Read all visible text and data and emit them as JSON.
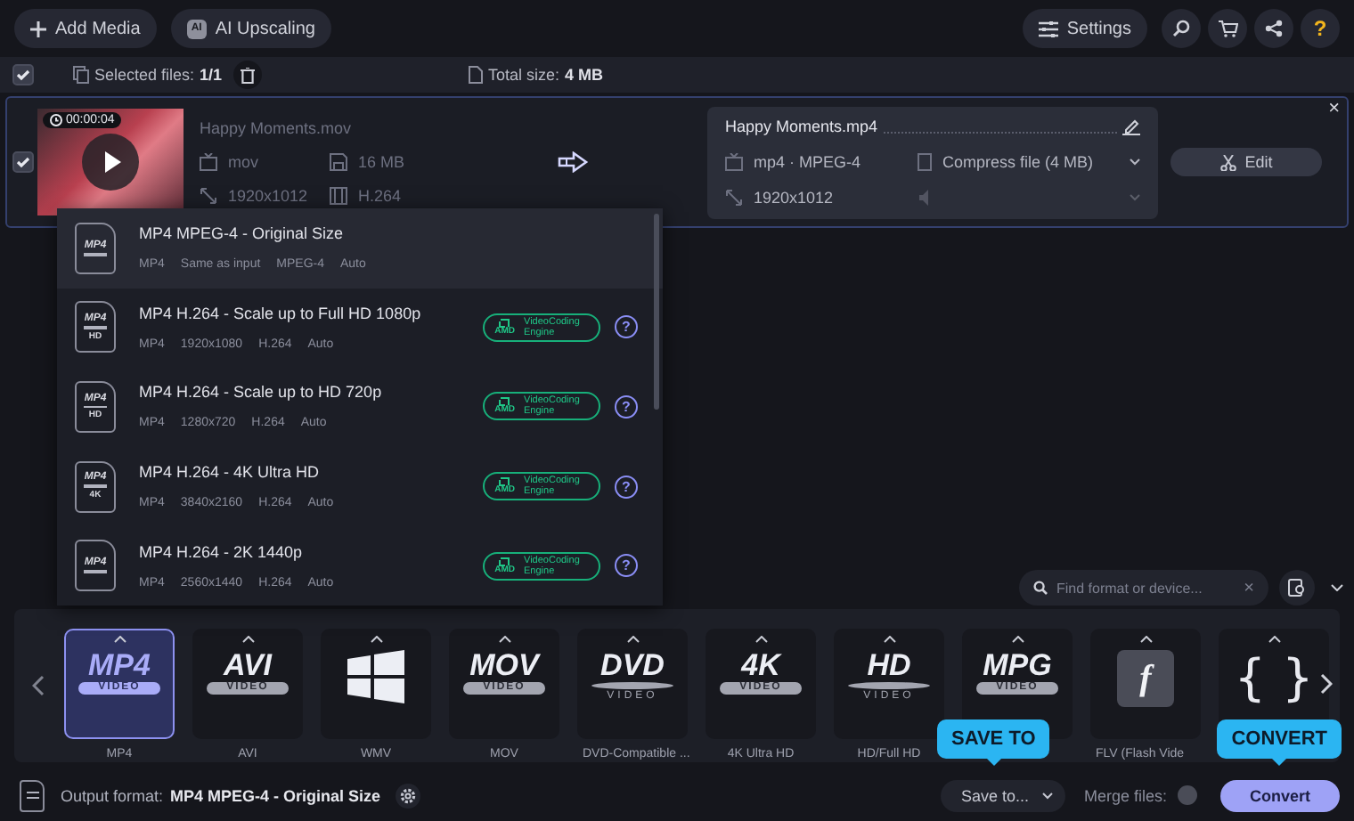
{
  "toolbar": {
    "left_buttons": [
      {
        "kind": "add",
        "label": "Add Media"
      },
      {
        "kind": "ai",
        "label": "AI Upscaling",
        "icon_text": "AI"
      }
    ],
    "settings": "Settings",
    "help": "?"
  },
  "selection": {
    "all_checked": true,
    "selected_label": "Selected files:",
    "selected_count": "1/1",
    "total_label": "Total size:",
    "total_value": "4 MB"
  },
  "file": {
    "checked": true,
    "duration": "00:00:04",
    "source": {
      "name": "Happy Moments.mov",
      "format": "mov",
      "size": "16 MB",
      "resolution": "1920x1012",
      "codec": "H.264"
    },
    "output": {
      "name": "Happy Moments.mp4",
      "format": "mp4 · MPEG-4",
      "compress": "Compress file (4 MB)",
      "resolution": "1920x1012",
      "audio_disabled": true
    },
    "edit": "Edit",
    "close": "×"
  },
  "presets": [
    {
      "title": "MP4 MPEG-4 - Original Size",
      "icon_label": "MP4",
      "specs": [
        "MP4",
        "Same as input",
        "MPEG-4",
        "Auto"
      ],
      "selected": true
    },
    {
      "title": "MP4 H.264 - Scale up to Full HD 1080p",
      "icon_label": "MP4",
      "icon_sub": "HD",
      "specs": [
        "MP4",
        "1920x1080",
        "H.264",
        "Auto"
      ],
      "badge": {
        "vendor": "AMD",
        "text": "VideoCoding Engine"
      },
      "help": "?",
      "selected": false
    },
    {
      "title": "MP4 H.264 - Scale up to HD 720p",
      "icon_label": "MP4",
      "icon_sub": "HD",
      "specs": [
        "MP4",
        "1280x720",
        "H.264",
        "Auto"
      ],
      "badge": {
        "vendor": "AMD",
        "text": "VideoCoding Engine"
      },
      "help": "?",
      "selected": false
    },
    {
      "title": "MP4 H.264 - 4K Ultra HD",
      "icon_label": "MP4",
      "icon_sub": "4K",
      "specs": [
        "MP4",
        "3840x2160",
        "H.264",
        "Auto"
      ],
      "badge": {
        "vendor": "AMD",
        "text": "VideoCoding Engine"
      },
      "help": "?",
      "selected": false
    },
    {
      "title": "MP4 H.264 - 2K 1440p",
      "icon_label": "MP4",
      "specs": [
        "MP4",
        "2560x1440",
        "H.264",
        "Auto"
      ],
      "badge": {
        "vendor": "AMD",
        "text": "VideoCoding Engine"
      },
      "help": "?",
      "selected": false
    }
  ],
  "format_search": {
    "placeholder": "Find format or device...",
    "clear": "×"
  },
  "formats": [
    {
      "kind": "band",
      "logo": "MP4",
      "sub": "VIDEO",
      "label": "MP4",
      "selected": true
    },
    {
      "kind": "band",
      "logo": "AVI",
      "sub": "VIDEO",
      "label": "AVI",
      "selected": false
    },
    {
      "kind": "windows",
      "label": "WMV",
      "selected": false
    },
    {
      "kind": "band",
      "logo": "MOV",
      "sub": "VIDEO",
      "label": "MOV",
      "selected": false
    },
    {
      "kind": "disc",
      "logo": "DVD",
      "sub": "VIDEO",
      "label": "DVD-Compatible ...",
      "selected": false
    },
    {
      "kind": "band",
      "logo": "4K",
      "sub": "VIDEO",
      "label": "4K Ultra HD",
      "selected": false
    },
    {
      "kind": "disc",
      "logo": "HD",
      "sub": "VIDEO",
      "label": "HD/Full HD",
      "selected": false
    },
    {
      "kind": "band",
      "logo": "MPG",
      "sub": "VIDEO",
      "selected": false
    },
    {
      "kind": "flash",
      "logo": "f",
      "label": "FLV (Flash Vide",
      "selected": false
    },
    {
      "kind": "braces",
      "logo": "{ }",
      "selected": false
    }
  ],
  "bottom": {
    "output_label": "Output format:",
    "output_value": "MP4 MPEG-4 - Original Size",
    "save_to": "Save to...",
    "merge_label": "Merge files:",
    "merge_on": false,
    "convert": "Convert"
  },
  "callouts": [
    {
      "text": "SAVE TO"
    },
    {
      "text": "CONVERT"
    }
  ]
}
